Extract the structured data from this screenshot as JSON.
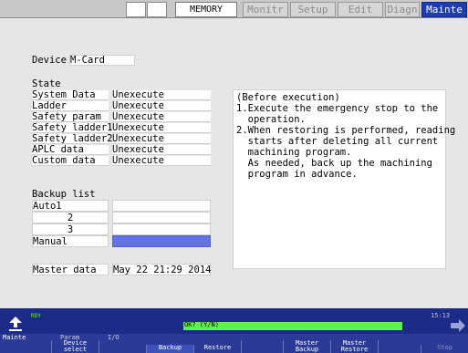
{
  "topbar": {
    "mode": "MEMORY",
    "tabs": [
      "Monitr",
      "Setup",
      "Edit",
      "Diagn",
      "Mainte"
    ],
    "active_tab": "Mainte"
  },
  "device": {
    "label": "Device",
    "value": "M-Card"
  },
  "state": {
    "title": "State",
    "rows": [
      {
        "name": "System Data",
        "value": "Unexecute"
      },
      {
        "name": "Ladder",
        "value": "Unexecute"
      },
      {
        "name": "Safety param",
        "value": "Unexecute"
      },
      {
        "name": "Safety ladder1",
        "value": "Unexecute"
      },
      {
        "name": "Safety ladder2",
        "value": "Unexecute"
      },
      {
        "name": "APLC data",
        "value": "Unexecute"
      },
      {
        "name": "Custom data",
        "value": "Unexecute"
      }
    ]
  },
  "message": {
    "lines": [
      "(Before execution)",
      "1.Execute the emergency stop to the",
      "  operation.",
      "2.When restoring is performed, reading",
      "  starts after deleting all current",
      "  machining program.",
      "  As needed, back up the machining",
      "  program in advance."
    ]
  },
  "backup_list": {
    "title": "Backup list",
    "rows": [
      {
        "name": "Auto1",
        "value": ""
      },
      {
        "name": "2",
        "value": ""
      },
      {
        "name": "3",
        "value": ""
      },
      {
        "name": "Manual",
        "value": ""
      }
    ],
    "selected_index": 3
  },
  "master_data": {
    "label": "Master data",
    "value": "May 22 21:29 2014"
  },
  "status": {
    "ready": "RDY",
    "prompt": "OK? (Y/N)",
    "clock": "15:13"
  },
  "menu": {
    "mode_label": "Mainte",
    "group_labels": [
      "Param",
      "I/O"
    ],
    "buttons": [
      {
        "label": "Device\nselect",
        "active": false,
        "dim": false
      },
      {
        "label": "",
        "active": false,
        "dim": false
      },
      {
        "label": "Backup",
        "active": true,
        "dim": false
      },
      {
        "label": "Restore",
        "active": false,
        "dim": false
      },
      {
        "label": "",
        "active": false,
        "dim": false
      },
      {
        "label": "Master\nBackup",
        "active": false,
        "dim": false
      },
      {
        "label": "Master\nRestore",
        "active": false,
        "dim": false
      },
      {
        "label": "",
        "active": false,
        "dim": false
      },
      {
        "label": "Stop",
        "active": false,
        "dim": true
      }
    ]
  },
  "colors": {
    "accent_tab": "#1e3cab",
    "status_bar": "#1c2a88",
    "prompt_bar": "#5ef24a",
    "selection": "#6274e0"
  }
}
